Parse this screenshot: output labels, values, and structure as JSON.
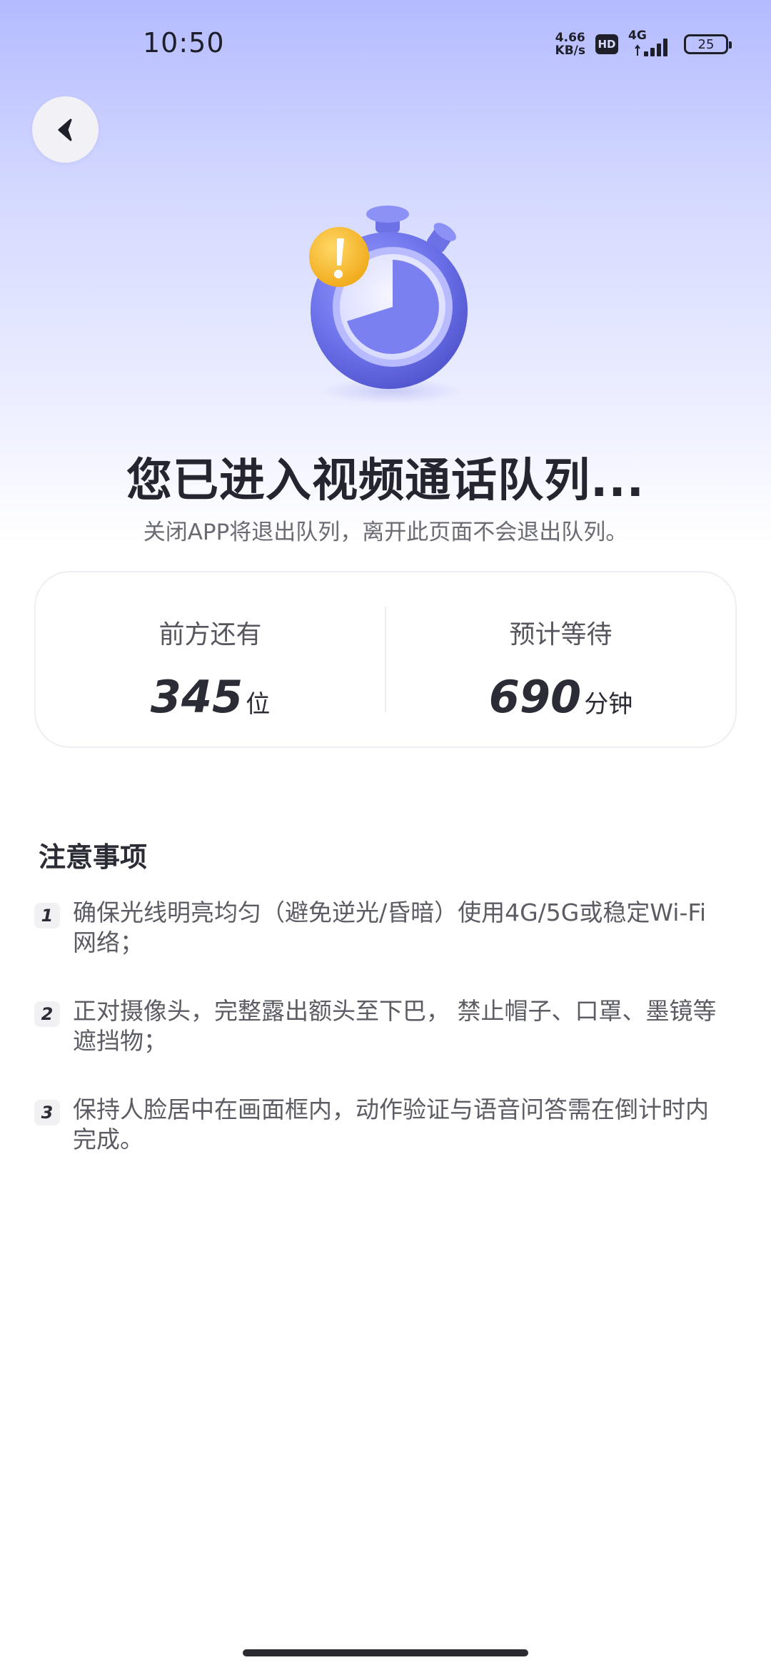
{
  "status_bar": {
    "time": "10:50",
    "net_speed_value": "4.66",
    "net_speed_unit": "KB/s",
    "hd_label": "HD",
    "network_type": "4G",
    "battery_level": "25"
  },
  "hero": {
    "title": "您已进入视频通话队列...",
    "subtitle": "关闭APP将退出队列，离开此页面不会退出队列。"
  },
  "stats": {
    "ahead_label": "前方还有",
    "ahead_value": "345",
    "ahead_unit": "位",
    "wait_label": "预计等待",
    "wait_value": "690",
    "wait_unit": "分钟"
  },
  "notes": {
    "title": "注意事项",
    "items": [
      {
        "num": "1",
        "text": "确保光线明亮均匀（避免逆光/昏暗）使用4G/5G或稳定Wi-Fi网络；"
      },
      {
        "num": "2",
        "text": "正对摄像头，完整露出额头至下巴， 禁止帽子、口罩、墨镜等遮挡物；"
      },
      {
        "num": "3",
        "text": "保持人脸居中在画面框内，动作验证与语音问答需在倒计时内完成。"
      }
    ]
  },
  "colors": {
    "accent": "#6f74e8",
    "badge": "#f5b82e",
    "background_top": "#b4bbff"
  },
  "icons": {
    "back": "chevron-left-icon",
    "hero": "stopwatch-alert-icon"
  }
}
